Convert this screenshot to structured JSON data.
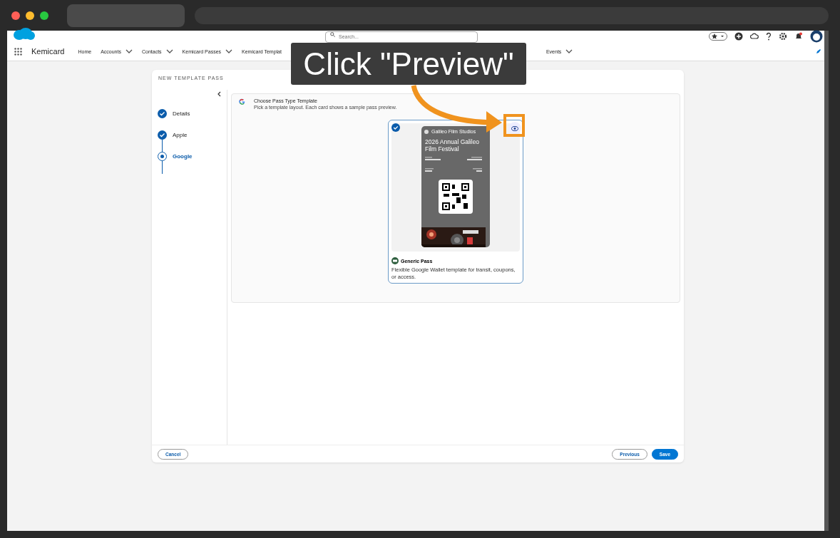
{
  "header": {
    "app_name": "Kemicard",
    "search": {
      "placeholder": "Search..."
    },
    "nav": [
      {
        "label": "Home",
        "has_menu": false
      },
      {
        "label": "Accounts",
        "has_menu": true
      },
      {
        "label": "Contacts",
        "has_menu": true
      },
      {
        "label": "Kemicard Passes",
        "has_menu": true
      },
      {
        "label": "Kemicard Templat",
        "has_menu": false
      }
    ],
    "nav_after_overlay": [
      {
        "label": "Events",
        "has_menu": true
      }
    ]
  },
  "wizard": {
    "title": "NEW TEMPLATE PASS",
    "steps": [
      {
        "label": "Details",
        "done": true,
        "selected": false
      },
      {
        "label": "Apple",
        "done": true,
        "selected": false
      },
      {
        "label": "Google",
        "done": false,
        "selected": true
      }
    ],
    "section": {
      "title": "Choose Pass Type Template",
      "subtitle": "Pick a template layout. Each card shows a sample pass preview."
    },
    "templates": [
      {
        "selected": true,
        "issuer": "Galileo Film Studios",
        "event": "2026 Annual Galileo Film Festival",
        "name": "Generic Pass",
        "description": "Flexible Google Wallet template for transit, coupons, or access."
      }
    ],
    "buttons": {
      "cancel": "Cancel",
      "previous": "Previous",
      "save": "Save"
    }
  },
  "callout": {
    "text": "Click \"Preview\""
  }
}
